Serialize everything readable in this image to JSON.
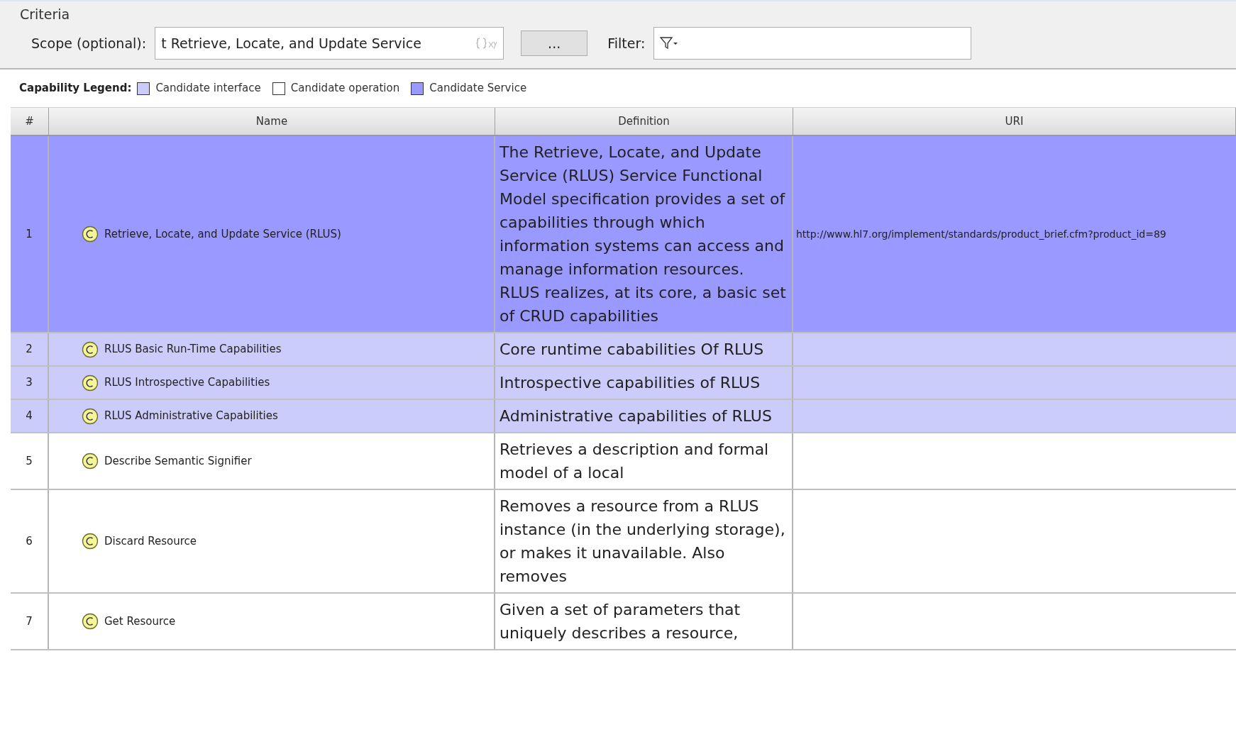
{
  "criteria": {
    "title": "Criteria",
    "scope_label": "Scope (optional):",
    "scope_value": "t Retrieve, Locate, and Update Service",
    "browse_button": "...",
    "filter_label": "Filter:"
  },
  "legend": {
    "title": "Capability Legend:",
    "items": [
      {
        "label": "Candidate interface",
        "color": "#ccccfa"
      },
      {
        "label": "Candidate operation",
        "color": "#ffffff"
      },
      {
        "label": "Candidate Service",
        "color": "#9999ff"
      }
    ]
  },
  "table": {
    "columns": [
      "#",
      "Name",
      "Definition",
      "URI"
    ],
    "rows": [
      {
        "kind": "service",
        "number": "1",
        "name": "Retrieve, Locate, and Update Service (RLUS)",
        "definition": "The Retrieve, Locate, and Update Service (RLUS) Service Functional Model specification provides a set of capabilities through which information systems can access and manage information resources. RLUS realizes, at its core, a basic set of CRUD capabilities",
        "uri": "http://www.hl7.org/implement/standards/product_brief.cfm?product_id=89"
      },
      {
        "kind": "interface",
        "number": "2",
        "name": "RLUS Basic Run-Time Capabilities",
        "definition": "Core runtime cababilities Of RLUS"
      },
      {
        "kind": "interface",
        "number": "3",
        "name": "RLUS Introspective Capabilities",
        "definition": "Introspective capabilities of RLUS"
      },
      {
        "kind": "interface",
        "number": "4",
        "name": "RLUS Administrative Capabilities",
        "definition": "Administrative capabilities of RLUS"
      },
      {
        "kind": "operation",
        "number": "5",
        "name": "Describe Semantic Signifier",
        "definition": "Retrieves a description and formal model of a local"
      },
      {
        "kind": "operation",
        "number": "6",
        "name": "Discard Resource",
        "definition": "Removes a resource from a RLUS instance (in the underlying storage), or makes it unavailable. Also removes"
      },
      {
        "kind": "operation",
        "number": "7",
        "name": "Get Resource",
        "definition": "Given a set of parameters that uniquely describes a resource,"
      }
    ]
  }
}
